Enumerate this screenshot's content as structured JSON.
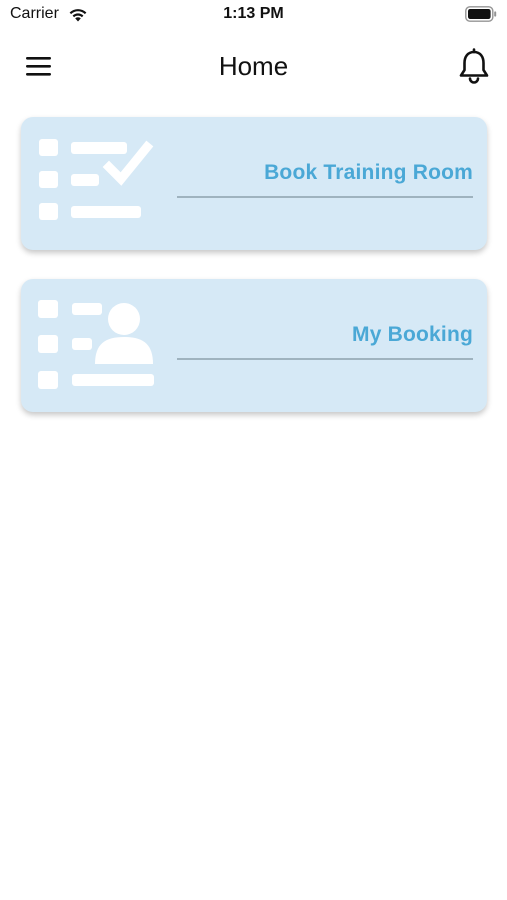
{
  "status_bar": {
    "carrier": "Carrier",
    "time": "1:13 PM",
    "icons": [
      "wifi-icon",
      "battery-icon"
    ]
  },
  "header": {
    "title": "Home",
    "left_icon": "menu-icon",
    "right_icon": "bell-icon"
  },
  "cards": [
    {
      "label": "Book Training Room",
      "icon": "checklist-icon"
    },
    {
      "label": "My Booking",
      "icon": "user-list-icon"
    }
  ],
  "colors": {
    "card_background": "#d6e9f6",
    "card_label": "#4aa8d6",
    "illustration": "#ffffff",
    "divider": "#9fb3bf"
  }
}
